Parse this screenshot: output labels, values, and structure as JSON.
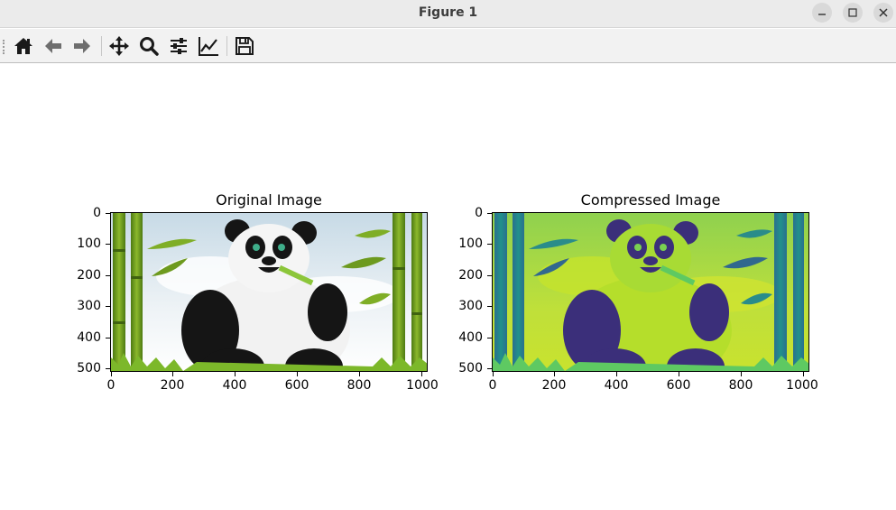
{
  "window": {
    "title": "Figure 1"
  },
  "toolbar": {
    "buttons": [
      {
        "name": "home-button",
        "icon": "home-icon"
      },
      {
        "name": "back-button",
        "icon": "arrow-left-icon"
      },
      {
        "name": "forward-button",
        "icon": "arrow-right-icon"
      },
      {
        "name": "pan-button",
        "icon": "move-icon"
      },
      {
        "name": "zoom-button",
        "icon": "search-icon"
      },
      {
        "name": "configure-subplots-button",
        "icon": "sliders-icon"
      },
      {
        "name": "edit-axis-button",
        "icon": "line-chart-icon"
      },
      {
        "name": "save-button",
        "icon": "floppy-disk-icon"
      }
    ]
  },
  "plots": [
    {
      "title": "Original Image",
      "yticks": [
        "0",
        "100",
        "200",
        "300",
        "400",
        "500"
      ],
      "xticks": [
        "0",
        "200",
        "400",
        "600",
        "800",
        "1000"
      ]
    },
    {
      "title": "Compressed Image",
      "yticks": [
        "0",
        "100",
        "200",
        "300",
        "400",
        "500"
      ],
      "xticks": [
        "0",
        "200",
        "400",
        "600",
        "800",
        "1000"
      ]
    }
  ],
  "colors": {
    "viridis_dark": "#3b2f7a",
    "viridis_mid": "#2a8c8a",
    "viridis_light": "#b9de2a",
    "bamboo_green": "#6d9a1e",
    "sky": "#dfe9ef"
  }
}
